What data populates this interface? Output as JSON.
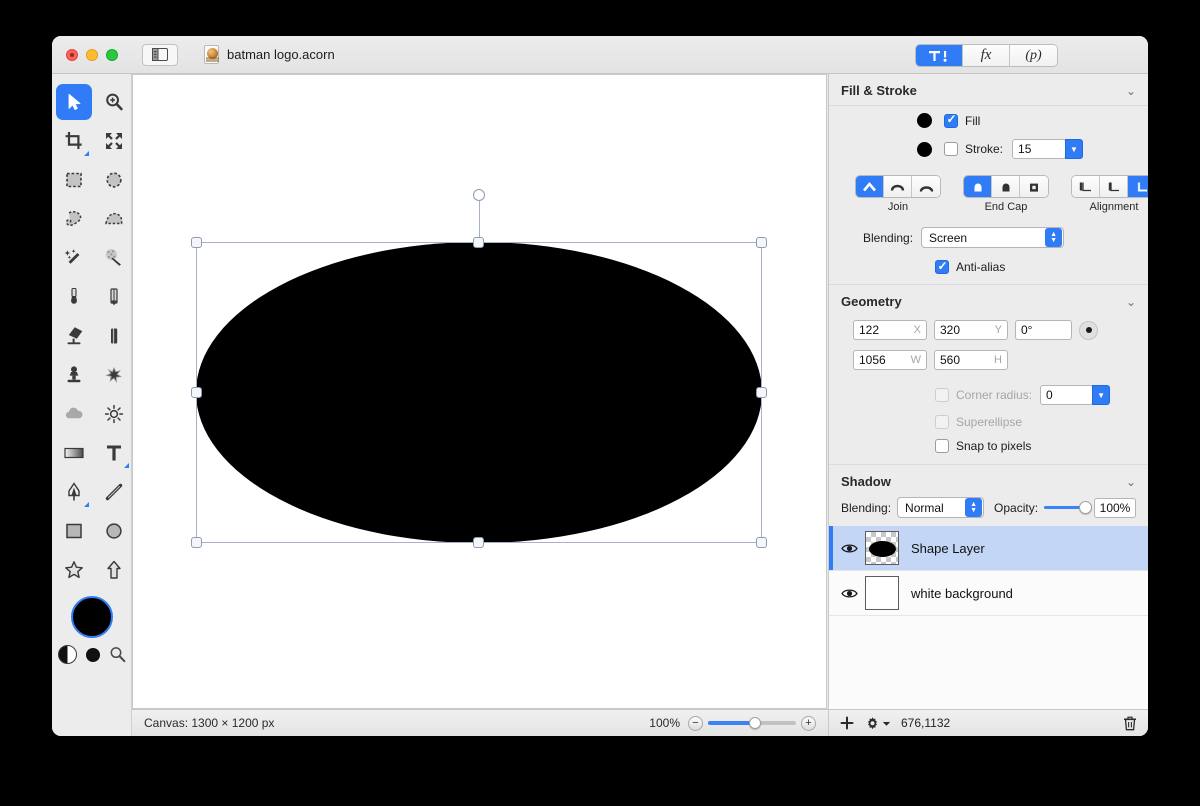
{
  "window": {
    "document_title": "batman logo.acorn",
    "traffic_lights": [
      "close-button",
      "minimize-button",
      "zoom-button"
    ],
    "sidebar_toggle_icon": "sidebar-toggle-icon",
    "doc_icon": "acorn-document-icon"
  },
  "segmented_tabs": [
    {
      "id": "tab-tools",
      "label": "",
      "icon": "tool-inspector-icon",
      "active": true
    },
    {
      "id": "tab-filters",
      "label": "fx",
      "icon": "fx-icon",
      "active": false
    },
    {
      "id": "tab-presets",
      "label": "(p)",
      "icon": "p-icon",
      "active": false
    }
  ],
  "tools": [
    {
      "name": "move-tool",
      "icon": "arrow-cursor-icon",
      "active": true
    },
    {
      "name": "zoom-tool",
      "icon": "magnifier-plus-icon",
      "active": false
    },
    {
      "name": "crop-tool",
      "icon": "crop-icon",
      "active": false
    },
    {
      "name": "transform-tool",
      "icon": "four-arrows-icon",
      "active": false
    },
    {
      "name": "rectangular-select-tool",
      "icon": "dashed-rect-icon",
      "active": false
    },
    {
      "name": "elliptical-select-tool",
      "icon": "dashed-ellipse-icon",
      "active": false
    },
    {
      "name": "lasso-tool",
      "icon": "lasso-icon",
      "active": false
    },
    {
      "name": "polygon-lasso-tool",
      "icon": "polygon-lasso-icon",
      "active": false
    },
    {
      "name": "magic-wand-tool",
      "icon": "magic-wand-icon",
      "active": false
    },
    {
      "name": "instant-alpha-tool",
      "icon": "sparkle-wand-icon",
      "active": false
    },
    {
      "name": "brush-tool",
      "icon": "paintbrush-icon",
      "active": false
    },
    {
      "name": "pencil-tool",
      "icon": "pencil-icon",
      "active": false
    },
    {
      "name": "paint-bucket-tool",
      "icon": "paint-bucket-icon",
      "active": false
    },
    {
      "name": "eraser-tool",
      "icon": "eraser-icon",
      "active": false
    },
    {
      "name": "clone-stamp-tool",
      "icon": "clone-stamp-icon",
      "active": false
    },
    {
      "name": "smudge-tool",
      "icon": "smudge-icon",
      "active": false
    },
    {
      "name": "blur-tool",
      "icon": "cloud-blur-icon",
      "active": false
    },
    {
      "name": "dodge-tool",
      "icon": "sun-dodge-icon",
      "active": false
    },
    {
      "name": "gradient-tool",
      "icon": "gradient-icon",
      "active": false
    },
    {
      "name": "text-tool",
      "icon": "text-t-icon",
      "active": false
    },
    {
      "name": "bezier-pen-tool",
      "icon": "pen-nib-icon",
      "active": false
    },
    {
      "name": "line-tool",
      "icon": "line-icon",
      "active": false
    },
    {
      "name": "rectangle-tool",
      "icon": "rectangle-icon",
      "active": false
    },
    {
      "name": "ellipse-tool",
      "icon": "ellipse-icon",
      "active": false
    },
    {
      "name": "star-tool",
      "icon": "star-icon",
      "active": false
    },
    {
      "name": "arrow-shape-tool",
      "icon": "up-arrow-icon",
      "active": false
    }
  ],
  "color_well": {
    "foreground": "#000000",
    "selection_ring": "#2f7cf6",
    "swap_icon": "swap-colors-icon",
    "secondary_icon": "secondary-color-icon",
    "loupe_icon": "color-loupe-icon"
  },
  "canvas": {
    "status_text": "Canvas: 1300 × 1200 px",
    "zoom_level": "100%",
    "zoom_out_icon": "zoom-out-icon",
    "zoom_in_icon": "zoom-in-icon",
    "shape": {
      "type": "ellipse",
      "fill": "#000000"
    }
  },
  "fill_stroke": {
    "title": "Fill & Stroke",
    "collapse_icon": "chevron-down-icon",
    "fill": {
      "label": "Fill",
      "checked": true,
      "color": "#000000"
    },
    "stroke": {
      "label": "Stroke:",
      "checked": false,
      "color": "#000000",
      "width": "15"
    },
    "join": {
      "label": "Join",
      "options": [
        "miter-join-icon",
        "round-join-icon",
        "bevel-join-icon"
      ],
      "selected": 0
    },
    "end_cap": {
      "label": "End Cap",
      "options": [
        "butt-cap-icon",
        "round-cap-icon",
        "square-cap-icon"
      ],
      "selected": 0
    },
    "alignment": {
      "label": "Alignment",
      "options": [
        "align-inner-icon",
        "align-center-icon",
        "align-outer-icon"
      ],
      "selected": 2
    },
    "blending": {
      "label": "Blending:",
      "value": "Screen"
    },
    "anti_alias": {
      "label": "Anti-alias",
      "checked": true
    }
  },
  "geometry": {
    "title": "Geometry",
    "collapse_icon": "chevron-down-icon",
    "x": {
      "value": "122",
      "unit": "X"
    },
    "y": {
      "value": "320",
      "unit": "Y"
    },
    "rotation": {
      "value": "0°"
    },
    "rotation_dial_icon": "rotation-dial-icon",
    "w": {
      "value": "1056",
      "unit": "W"
    },
    "h": {
      "value": "560",
      "unit": "H"
    },
    "corner_radius": {
      "label": "Corner radius:",
      "checked": false,
      "value": "0",
      "disabled": true
    },
    "superellipse": {
      "label": "Superellipse",
      "checked": false,
      "disabled": true
    },
    "snap_to_pixels": {
      "label": "Snap to pixels",
      "checked": false,
      "disabled": false
    }
  },
  "shadow": {
    "title": "Shadow",
    "collapse_icon": "chevron-down-icon",
    "blending": {
      "label": "Blending:",
      "value": "Normal"
    },
    "opacity": {
      "label": "Opacity:",
      "value": "100%",
      "percent": 100
    }
  },
  "layers": [
    {
      "name": "Shape Layer",
      "selected": true,
      "visible": true,
      "eye_icon": "eye-icon",
      "thumbnail": "shape-layer-thumbnail"
    },
    {
      "name": "white background",
      "selected": false,
      "visible": true,
      "eye_icon": "eye-icon",
      "thumbnail": "white-background-thumbnail"
    }
  ],
  "layer_toolbar": {
    "add_icon": "plus-icon",
    "settings_icon": "gear-icon",
    "settings_chevron_icon": "chevron-down-small-icon",
    "coordinates": "676,1132",
    "delete_icon": "trash-icon"
  }
}
